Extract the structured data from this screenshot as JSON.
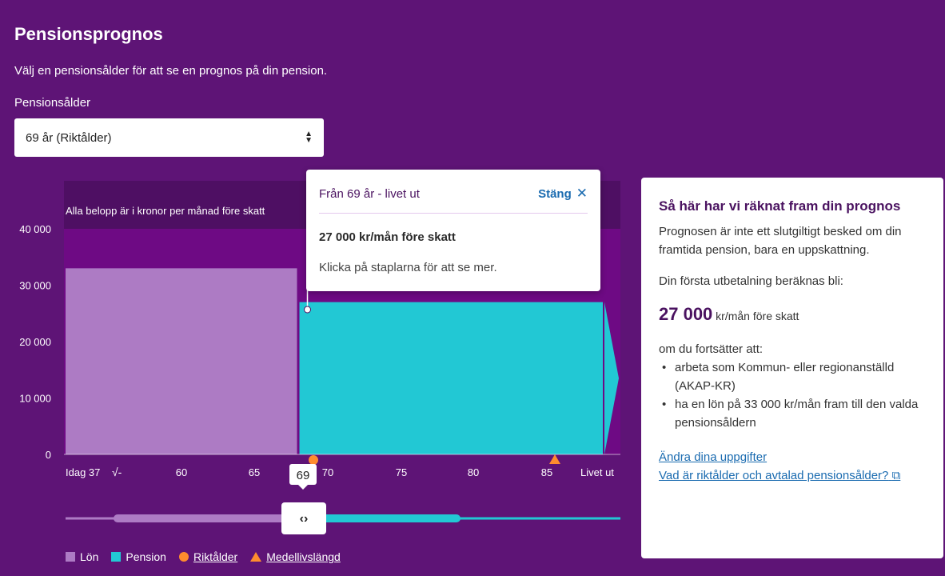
{
  "page": {
    "title": "Pensionsprognos",
    "subtitle": "Välj en pensionsålder för att se en prognos på din pension.",
    "select_label": "Pensionsålder",
    "select_value": "69 år (Riktålder)"
  },
  "chart_data": {
    "type": "area",
    "title": "Alla belopp är i kronor per månad före skatt",
    "yticks": [
      "40 000",
      "30 000",
      "20 000",
      "10 000",
      "0"
    ],
    "ylim": [
      0,
      40000
    ],
    "xticks": [
      "Idag 37",
      "60",
      "65",
      "70",
      "75",
      "80",
      "85",
      "Livet ut"
    ],
    "series": [
      {
        "name": "Lön",
        "from": "Idag 37",
        "to": "69",
        "value": 33000
      },
      {
        "name": "Pension",
        "from": "69",
        "to": "Livet ut",
        "value": 27000
      }
    ],
    "markers": {
      "riktalder": 69,
      "medellivslangd": 85
    },
    "selected_age_label": "69",
    "slider_handle": "‹›",
    "colors": {
      "lon": "#ad7bc4",
      "pension": "#22c8d4",
      "riktalder": "#ff8c2e",
      "background": "#5e1476",
      "band": "#6e0a84"
    }
  },
  "tooltip": {
    "title": "Från 69 år - livet ut",
    "close_label": "Stäng",
    "amount": "27 000 kr/mån före skatt",
    "hint": "Klicka på staplarna för att se mer."
  },
  "info": {
    "heading": "Så här har vi räknat fram din prognos",
    "intro": "Prognosen är inte ett slutgiltigt besked om din framtida pension, bara en uppskattning.",
    "first_payment": "Din första utbetalning beräknas bli:",
    "amount_big": "27 000",
    "amount_unit": " kr/mån före skatt",
    "condition": "om du fortsätter att:",
    "bullets": [
      "arbeta som Kommun- eller regionanställd (AKAP-KR)",
      "ha en lön på 33 000 kr/mån fram till den valda pensionsåldern"
    ],
    "link1": "Ändra dina uppgifter",
    "link2": "Vad är riktålder och avtalad pensionsålder?"
  },
  "legend": {
    "lon": "Lön",
    "pension": "Pension",
    "riktalder": "Riktålder",
    "medellivslangd": "Medellivslängd"
  }
}
